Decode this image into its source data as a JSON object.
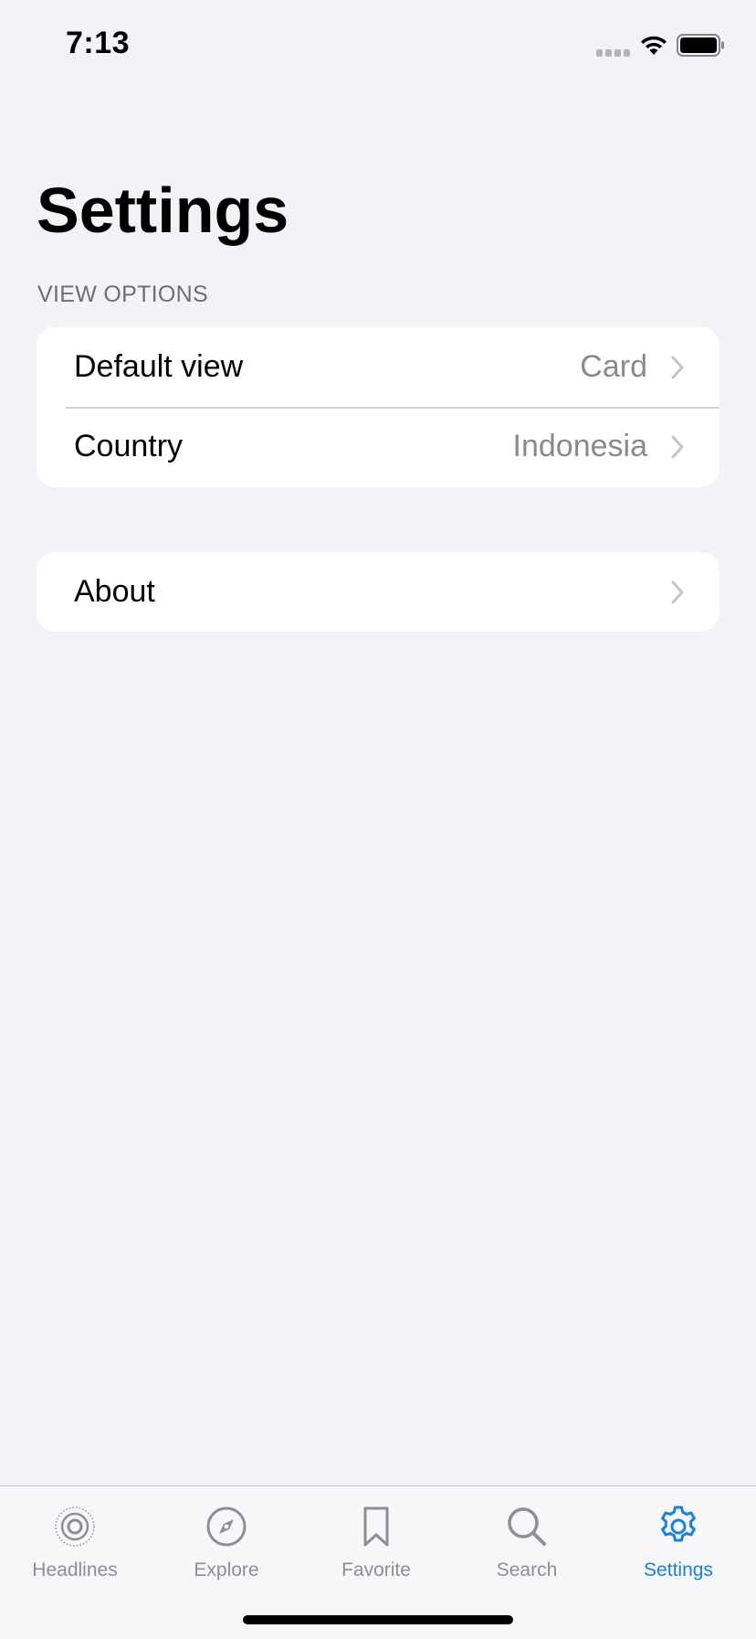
{
  "status_bar": {
    "time": "7:13",
    "icons": [
      "signal-icon",
      "wifi-icon",
      "battery-icon"
    ]
  },
  "page": {
    "title": "Settings"
  },
  "view_options": {
    "header": "VIEW OPTIONS",
    "rows": [
      {
        "label": "Default view",
        "value": "Card",
        "icon": "chevron-right-icon"
      },
      {
        "label": "Country",
        "value": "Indonesia",
        "icon": "chevron-right-icon"
      }
    ]
  },
  "about_group": {
    "rows": [
      {
        "label": "About",
        "icon": "chevron-right-icon"
      }
    ]
  },
  "tab_bar": {
    "active_color": "#1a7fde",
    "inactive_color": "#8e8e93",
    "tabs": [
      {
        "label": "Headlines",
        "icon": "headlines-icon",
        "active": false
      },
      {
        "label": "Explore",
        "icon": "compass-icon",
        "active": false
      },
      {
        "label": "Favorite",
        "icon": "bookmark-icon",
        "active": false
      },
      {
        "label": "Search",
        "icon": "search-icon",
        "active": false
      },
      {
        "label": "Settings",
        "icon": "gear-icon",
        "active": true
      }
    ]
  }
}
